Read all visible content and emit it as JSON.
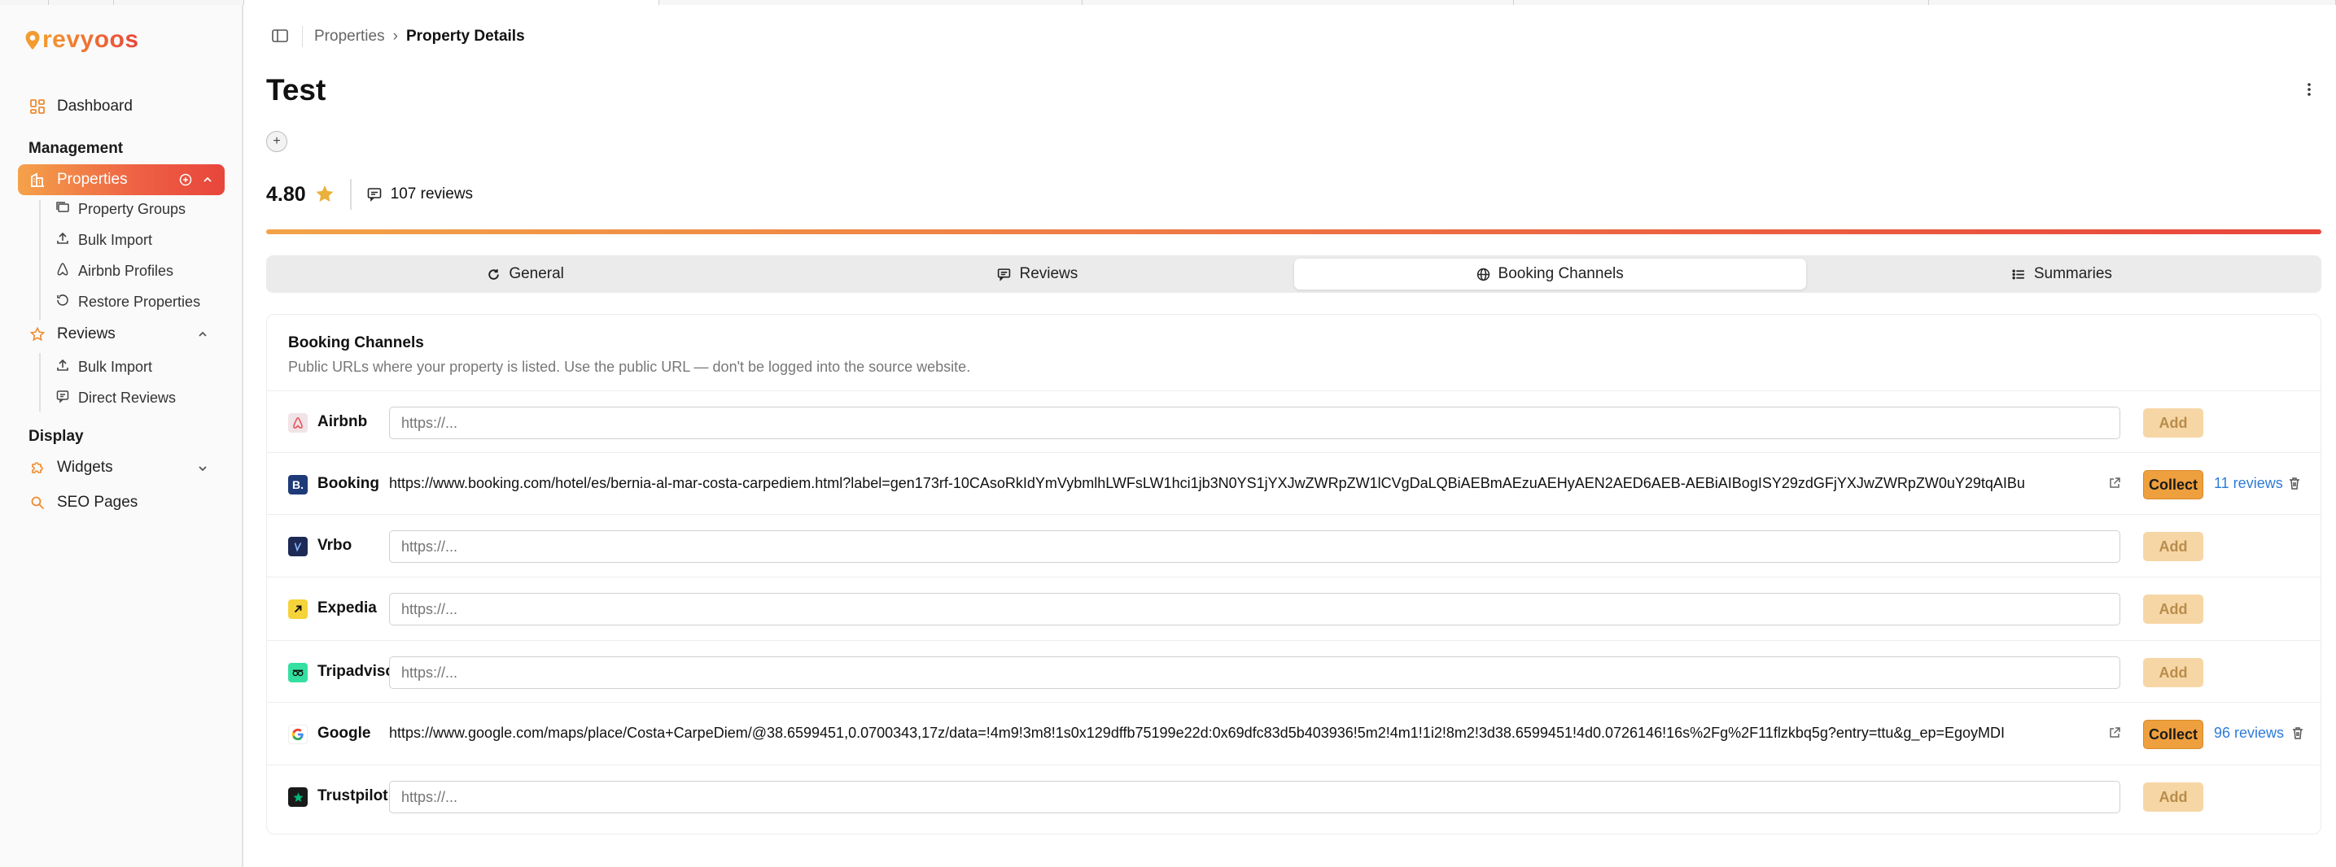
{
  "app": {
    "logo_text": "revyoos"
  },
  "sidebar": {
    "dashboard": "Dashboard",
    "management_label": "Management",
    "properties": "Properties",
    "property_sub": [
      "Property Groups",
      "Bulk Import",
      "Airbnb Profiles",
      "Restore Properties"
    ],
    "reviews": "Reviews",
    "reviews_sub": [
      "Bulk Import",
      "Direct Reviews"
    ],
    "display_label": "Display",
    "widgets": "Widgets",
    "seo_pages": "SEO Pages"
  },
  "breadcrumb": {
    "parent": "Properties",
    "separator": "›",
    "current": "Property Details"
  },
  "page": {
    "title": "Test",
    "plus_label": "+",
    "rating": "4.80",
    "reviews_count": "107 reviews"
  },
  "tabs": [
    {
      "label": "General",
      "icon": "refresh-icon"
    },
    {
      "label": "Reviews",
      "icon": "message-icon"
    },
    {
      "label": "Booking Channels",
      "icon": "globe-icon",
      "active": true
    },
    {
      "label": "Summaries",
      "icon": "list-icon"
    }
  ],
  "card": {
    "title": "Booking Channels",
    "description": "Public URLs where your property is listed. Use the public URL — don't be logged into the source website."
  },
  "channels": [
    {
      "name": "Airbnb",
      "color": "#e8505b",
      "placeholder": "https://...",
      "button": "Add"
    },
    {
      "name": "Booking",
      "color": "#1e3a78",
      "url": "https://www.booking.com/hotel/es/bernia-al-mar-costa-carpediem.html?label=gen173rf-10CAsoRkIdYmVybmlhLWFsLW1hci1jb3N0YS1jYXJwZWRpZW1lCVgDaLQBiAEBmAEzuAEHyAEN2AED6AEB-AEBiAIBogISY29zdGFjYXJwZWRpZW0uY29tqAIBu",
      "button": "Collect",
      "reviews": "11 reviews"
    },
    {
      "name": "Vrbo",
      "color": "#1d2a55",
      "placeholder": "https://...",
      "button": "Add"
    },
    {
      "name": "Expedia",
      "color": "#f5d33a",
      "placeholder": "https://...",
      "button": "Add"
    },
    {
      "name": "Tripadvisor",
      "color": "#34e0a1",
      "placeholder": "https://...",
      "button": "Add"
    },
    {
      "name": "Google",
      "color": "#ffffff",
      "url": "https://www.google.com/maps/place/Costa+CarpeDiem/@38.6599451,0.0700343,17z/data=!4m9!3m8!1s0x129dffb75199e22d:0x69dfc83d5b403936!5m2!4m1!1i2!8m2!3d38.6599451!4d0.0726146!16s%2Fg%2F11flzkbq5g?entry=ttu&g_ep=EgoyMDI",
      "button": "Collect",
      "reviews": "96 reviews"
    },
    {
      "name": "Trustpilot",
      "color": "#1a1a1a",
      "placeholder": "https://...",
      "button": "Add"
    }
  ],
  "colors": {
    "accent_start": "#f4a24a",
    "accent_end": "#e8453b",
    "link": "#2d7bd8"
  }
}
